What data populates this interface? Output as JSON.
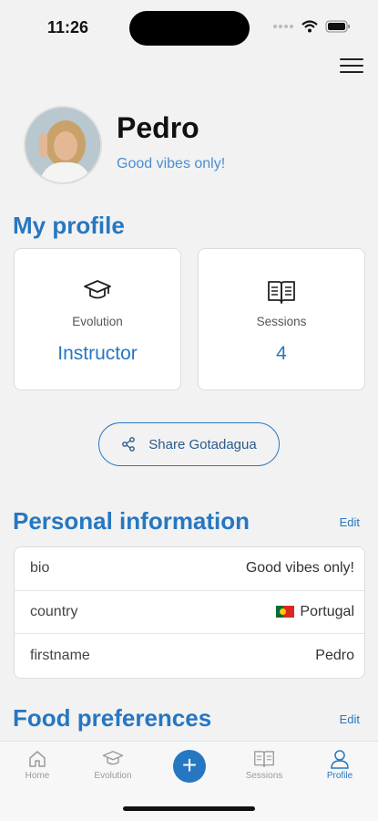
{
  "status_bar": {
    "time": "11:26"
  },
  "profile": {
    "name": "Pedro",
    "motto": "Good vibes only!"
  },
  "my_profile": {
    "title": "My profile",
    "cards": [
      {
        "icon": "graduation-cap-icon",
        "label": "Evolution",
        "value": "Instructor"
      },
      {
        "icon": "book-icon",
        "label": "Sessions",
        "value": "4"
      }
    ],
    "share_label": "Share Gotadagua"
  },
  "personal_information": {
    "title": "Personal information",
    "edit_label": "Edit",
    "rows": [
      {
        "key": "bio",
        "value": "Good vibes only!"
      },
      {
        "key": "country",
        "value": "Portugal",
        "flag": "portugal-flag-icon"
      },
      {
        "key": "firstname",
        "value": "Pedro"
      }
    ]
  },
  "food_preferences": {
    "title": "Food preferences",
    "edit_label": "Edit"
  },
  "tab_bar": {
    "tabs": [
      {
        "icon": "home-icon",
        "label": "Home"
      },
      {
        "icon": "graduation-cap-icon",
        "label": "Evolution"
      },
      {
        "icon": "plus-icon",
        "label": "+"
      },
      {
        "icon": "book-icon",
        "label": "Sessions"
      },
      {
        "icon": "user-icon",
        "label": "Profile"
      }
    ],
    "active": "Profile"
  },
  "colors": {
    "accent": "#2677c2",
    "background": "#f2f2f2",
    "tab_inactive": "#9a9a9a"
  }
}
